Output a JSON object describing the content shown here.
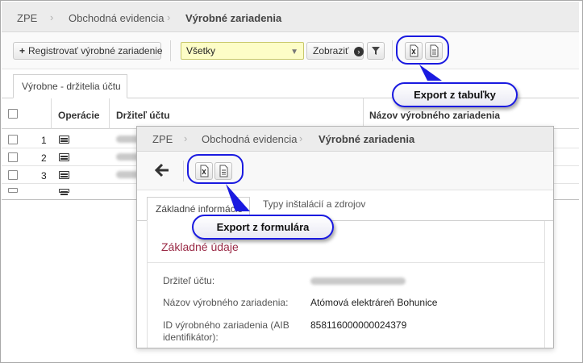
{
  "background_window": {
    "breadcrumb": [
      "ZPE",
      "Obchodná evidencia",
      "Výrobné zariadenia"
    ],
    "toolbar": {
      "register_label": "Registrovať výrobné zariadenie",
      "filter_value": "Všetky",
      "show_label": "Zobraziť"
    },
    "tab_label": "Výrobne - držitelia účtu",
    "columns": [
      "Operácie",
      "Držiteľ účtu",
      "Názov výrobného zariadenia"
    ],
    "rows": [
      {
        "num": "1"
      },
      {
        "num": "2"
      },
      {
        "num": "3"
      }
    ]
  },
  "front_window": {
    "breadcrumb": [
      "ZPE",
      "Obchodná evidencia",
      "Výrobné zariadenia"
    ],
    "tabs": [
      "Základné informácie",
      "Typy inštalácií a zdrojov"
    ],
    "section_title": "Základné údaje",
    "fields": [
      {
        "label": "Držiteľ účtu:",
        "value": ""
      },
      {
        "label": "Názov výrobného zariadenia:",
        "value": "Atómová elektráreň Bohunice"
      },
      {
        "label": "ID výrobného zariadenia (AIB identifikátor):",
        "value": "858116000000024379"
      }
    ]
  },
  "callouts": {
    "table_export": "Export z tabuľky",
    "form_export": "Export z formulára"
  },
  "colors": {
    "callout_border": "#1a1ae0",
    "section_title": "#9a2a46",
    "filter_background": "#fdfdc7"
  }
}
